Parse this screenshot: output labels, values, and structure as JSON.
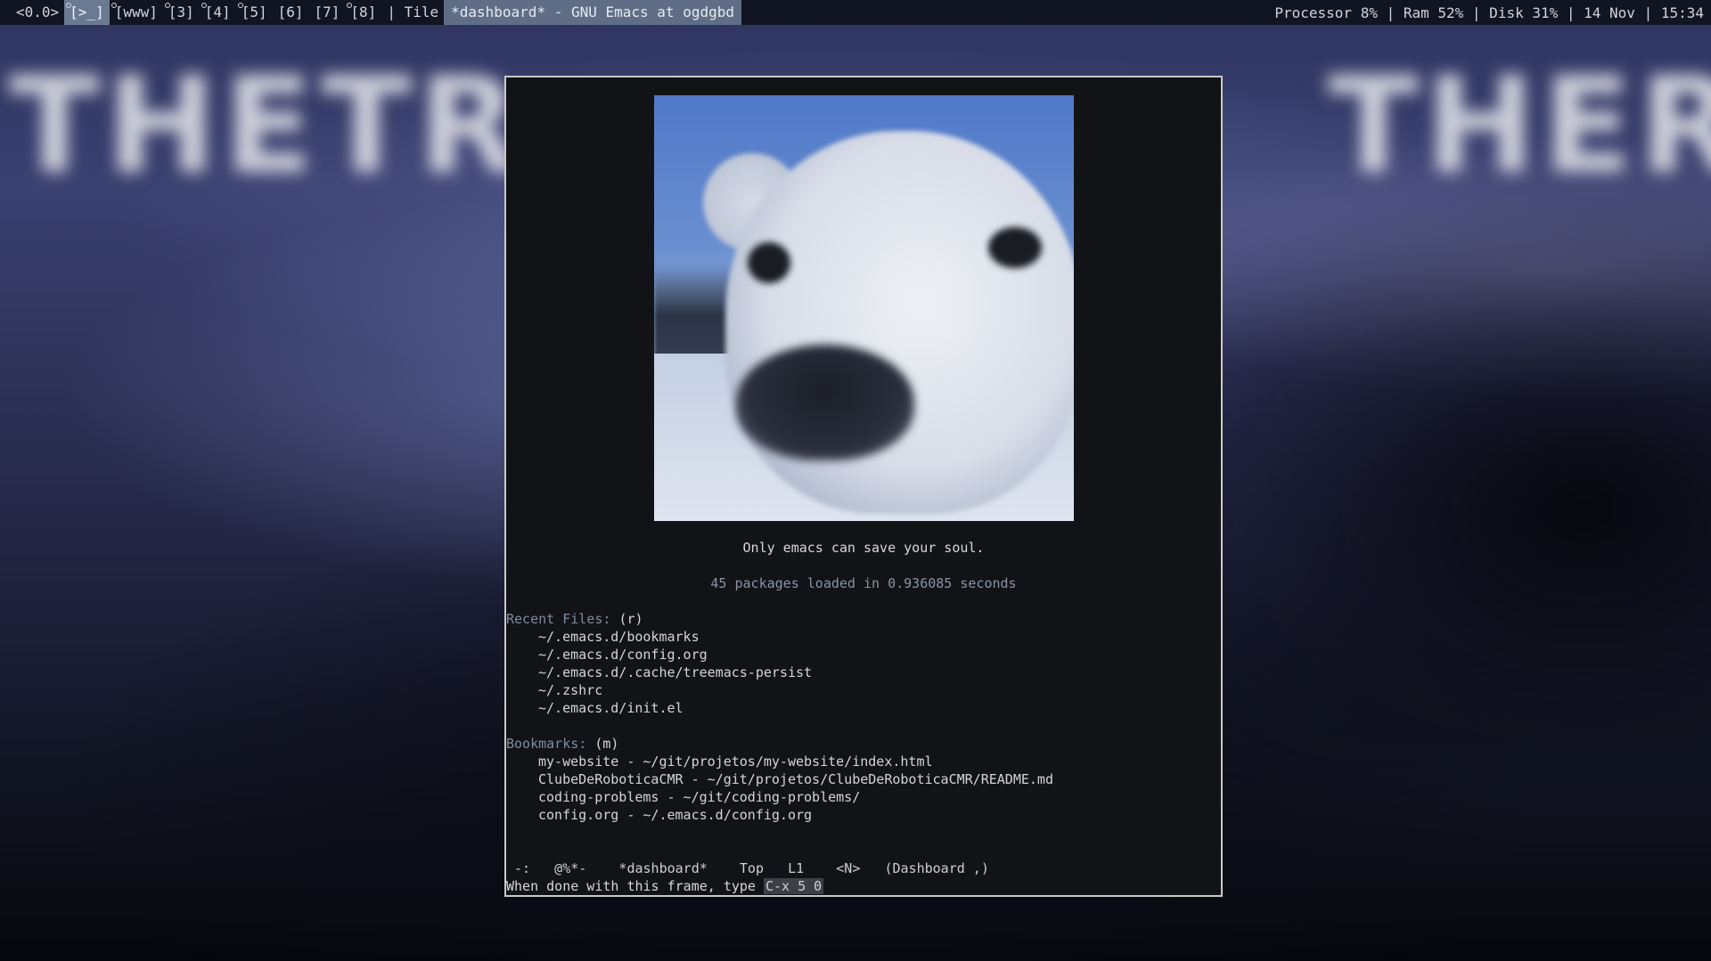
{
  "topbar": {
    "layout_indicator": "<0.0>",
    "workspaces": [
      {
        "label": "[>_]",
        "active": true,
        "urgent": true
      },
      {
        "label": "[www]",
        "active": false,
        "urgent": true
      },
      {
        "label": "[3]",
        "active": false,
        "urgent": true
      },
      {
        "label": "[4]",
        "active": false,
        "urgent": true
      },
      {
        "label": "[5]",
        "active": false,
        "urgent": true
      },
      {
        "label": "[6]",
        "active": false,
        "urgent": false
      },
      {
        "label": "[7]",
        "active": false,
        "urgent": false
      },
      {
        "label": "[8]",
        "active": false,
        "urgent": true
      }
    ],
    "layout_name": "| Tile",
    "window_title": "*dashboard* - GNU Emacs at ogdgbd",
    "status": "Processor 8% | Ram 52% | Disk 31% | 14 Nov | 15:34"
  },
  "wallpaper": {
    "text_left": "THE",
    "text_mid": "TR",
    "text_right": "THERE"
  },
  "dashboard": {
    "tagline": "Only emacs can save your soul.",
    "load_info": "45 packages loaded in 0.936085 seconds",
    "recent_heading": "Recent Files:",
    "recent_key": "(r)",
    "recent_files": [
      "~/.emacs.d/bookmarks",
      "~/.emacs.d/config.org",
      "~/.emacs.d/.cache/treemacs-persist",
      "~/.zshrc",
      "~/.emacs.d/init.el"
    ],
    "bookmarks_heading": "Bookmarks:",
    "bookmarks_key": "(m)",
    "bookmarks": [
      "my-website - ~/git/projetos/my-website/index.html",
      "ClubeDeRoboticaCMR - ~/git/projetos/ClubeDeRoboticaCMR/README.md",
      "coding-problems - ~/git/coding-problems/",
      "config.org - ~/.emacs.d/config.org"
    ],
    "mode_line": " -:   @%*-    *dashboard*    Top   L1    <N>   (Dashboard ,)",
    "echo_prefix": "When done with this frame, type ",
    "echo_key": "C-x 5 0"
  },
  "colors": {
    "topbar_bg": "#111521",
    "active_workspace": "#6b7a93",
    "frame_bg": "#121317",
    "heading": "#7e8ba0"
  }
}
